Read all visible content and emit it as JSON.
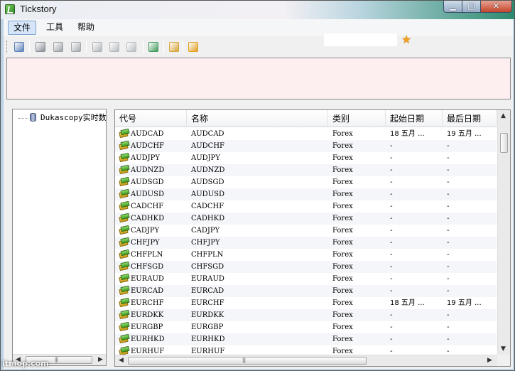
{
  "window": {
    "title": "Tickstory",
    "min_glyph": "▁",
    "max_glyph": "□",
    "close_glyph": "✕"
  },
  "menu": {
    "items": [
      "文件",
      "工具",
      "帮助"
    ]
  },
  "toolbar": {
    "buttons": [
      {
        "icon": "gear-icon",
        "color": "#5a7fb8"
      },
      {
        "icon": "print-icon",
        "color": "#8a8f96"
      },
      {
        "icon": "grid-icon",
        "color": "#9aa0a6"
      },
      {
        "icon": "copy-icon",
        "color": "#a4a9ae"
      },
      {
        "icon": "doc-icon",
        "color": "#b0b4b9"
      },
      {
        "icon": "chart-icon",
        "color": "#b6babf"
      },
      {
        "icon": "window-icon",
        "color": "#b8bcc0"
      },
      {
        "icon": "export-icon",
        "color": "#3f9a5a"
      },
      {
        "icon": "edit-icon",
        "color": "#d7a43a"
      },
      {
        "icon": "lock-icon",
        "color": "#e0a020"
      }
    ]
  },
  "tree": {
    "root_label": "Dukascopy实时数据"
  },
  "table": {
    "columns": [
      "代号",
      "名称",
      "类别",
      "起始日期",
      "最后日期"
    ],
    "rows": [
      [
        "AUDCAD",
        "AUDCAD",
        "Forex",
        "18 五月 ...",
        "19 五月 ..."
      ],
      [
        "AUDCHF",
        "AUDCHF",
        "Forex",
        "-",
        "-"
      ],
      [
        "AUDJPY",
        "AUDJPY",
        "Forex",
        "-",
        "-"
      ],
      [
        "AUDNZD",
        "AUDNZD",
        "Forex",
        "-",
        "-"
      ],
      [
        "AUDSGD",
        "AUDSGD",
        "Forex",
        "-",
        "-"
      ],
      [
        "AUDUSD",
        "AUDUSD",
        "Forex",
        "-",
        "-"
      ],
      [
        "CADCHF",
        "CADCHF",
        "Forex",
        "-",
        "-"
      ],
      [
        "CADHKD",
        "CADHKD",
        "Forex",
        "-",
        "-"
      ],
      [
        "CADJPY",
        "CADJPY",
        "Forex",
        "-",
        "-"
      ],
      [
        "CHFJPY",
        "CHFJPY",
        "Forex",
        "-",
        "-"
      ],
      [
        "CHFPLN",
        "CHFPLN",
        "Forex",
        "-",
        "-"
      ],
      [
        "CHFSGD",
        "CHFSGD",
        "Forex",
        "-",
        "-"
      ],
      [
        "EURAUD",
        "EURAUD",
        "Forex",
        "-",
        "-"
      ],
      [
        "EURCAD",
        "EURCAD",
        "Forex",
        "-",
        "-"
      ],
      [
        "EURCHF",
        "EURCHF",
        "Forex",
        "18 五月 ...",
        "19 五月 ..."
      ],
      [
        "EURDKK",
        "EURDKK",
        "Forex",
        "-",
        "-"
      ],
      [
        "EURGBP",
        "EURGBP",
        "Forex",
        "-",
        "-"
      ],
      [
        "EURHKD",
        "EURHKD",
        "Forex",
        "-",
        "-"
      ],
      [
        "EURHUF",
        "EURHUF",
        "Forex",
        "-",
        "-"
      ]
    ]
  },
  "watermark": "itmop.com"
}
